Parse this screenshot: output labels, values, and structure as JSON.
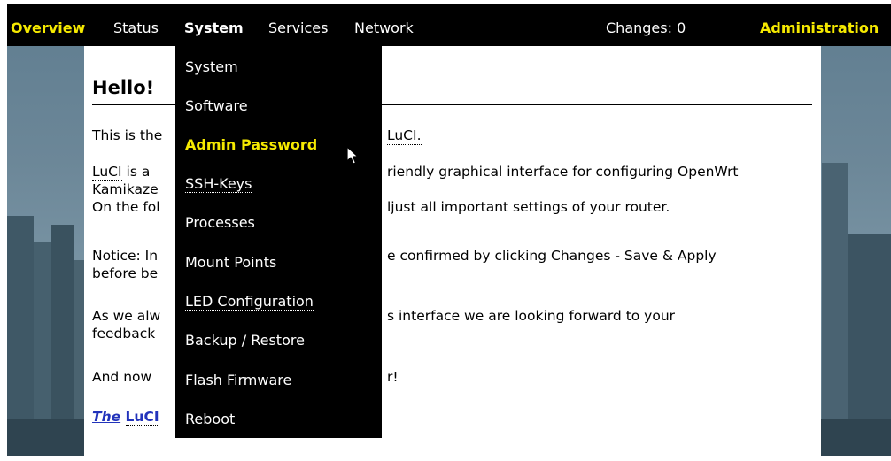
{
  "menubar": {
    "overview": "Overview",
    "status": "Status",
    "system": "System",
    "services": "Services",
    "network": "Network",
    "changes": "Changes: 0",
    "administration": "Administration"
  },
  "content": {
    "title": "Hello!",
    "p1": "This is the",
    "p1_end": "LuCI.",
    "p2_start": "LuCI",
    "p2_a": " is a",
    "p2_end": "riendly graphical interface for configuring OpenWrt",
    "p2_line2": "Kamikaze",
    "p2_line3_start": "On the fol",
    "p2_line3_end": "ljust all important settings of your router.",
    "p3_start": "Notice: In",
    "p3_end": "e confirmed by clicking Changes - Save & Apply",
    "p3_line2": "before be",
    "p4_start": "As we alw",
    "p4_end": "s interface we are looking forward to your",
    "p4_line2": "feedback",
    "p5_start": "And now",
    "p5_end": "r!",
    "sig_the": "The",
    "sig_luci": "LuCI"
  },
  "dropdown": {
    "items": [
      {
        "label": "System"
      },
      {
        "label": "Software"
      },
      {
        "label": "Admin Password"
      },
      {
        "label": "SSH-Keys"
      },
      {
        "label": "Processes"
      },
      {
        "label": "Mount Points"
      },
      {
        "label": "LED Configuration"
      },
      {
        "label": "Backup / Restore"
      },
      {
        "label": "Flash Firmware"
      },
      {
        "label": "Reboot"
      }
    ]
  },
  "colors": {
    "accent": "#f5e900",
    "menubar": "#000000",
    "link": "#2233bb"
  }
}
